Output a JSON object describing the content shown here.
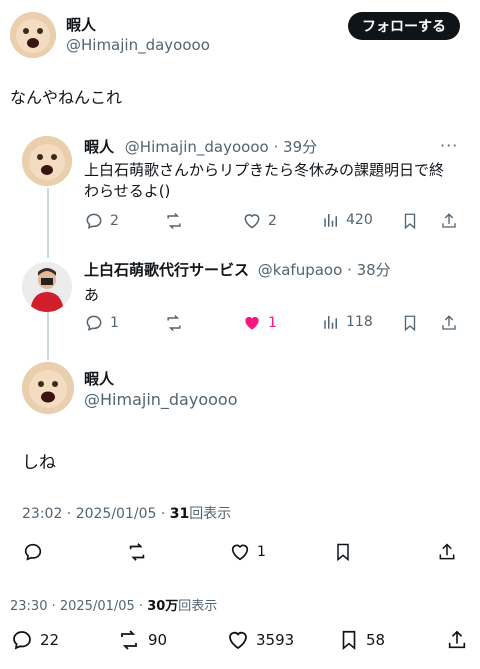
{
  "main_tweet": {
    "display_name": "暇人",
    "handle": "@Himajin_dayoooo",
    "follow_label": "フォローする",
    "text": "なんやねんこれ",
    "stats": {
      "replies": "22",
      "retweets": "90",
      "likes": "3593",
      "bookmarks": "58"
    },
    "timestamp": "23:30 · 2025/01/05 · ",
    "views_count": "30万",
    "views_suffix": "回表示"
  },
  "quoted_thread": {
    "reply1": {
      "display_name": "暇人",
      "handle": "@Himajin_dayoooo",
      "time": "· 39分",
      "text": "上白石萌歌さんからリプきたら冬休みの課題明日で終わらせるよ()",
      "stats": {
        "replies": "2",
        "likes": "2",
        "views": "420"
      }
    },
    "reply2": {
      "display_name": "上白石萌歌代行サービス",
      "handle": "@kafupaoo",
      "time": "· 38分",
      "text": "あ",
      "stats": {
        "replies": "1",
        "likes": "1",
        "views": "118"
      }
    },
    "reply3": {
      "display_name": "暇人",
      "handle": "@Himajin_dayoooo",
      "text": "しね",
      "timestamp": "23:02 · 2025/01/05 · ",
      "views_count": "31",
      "views_suffix": "回表示",
      "stats": {
        "likes": "1"
      }
    }
  },
  "colors": {
    "like_active": "#f91880",
    "text_secondary": "#536471",
    "line": "#cfd9de"
  }
}
